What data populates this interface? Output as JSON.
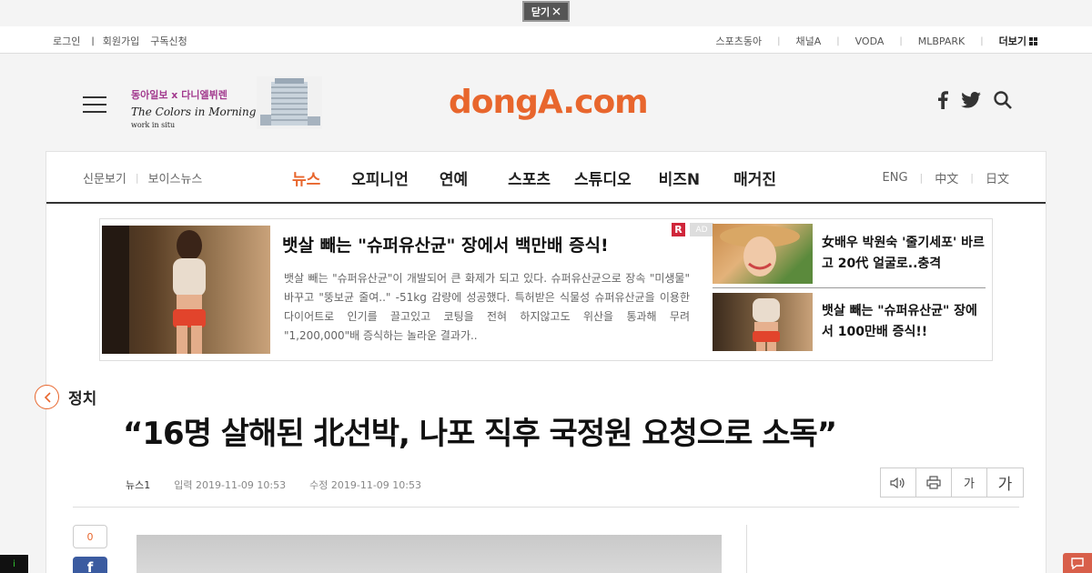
{
  "closebar": {
    "label": "닫기",
    "icon": "close-icon"
  },
  "util": {
    "left": [
      "로그인",
      "회원가입",
      "구독신청"
    ],
    "right": [
      "스포츠동아",
      "채널A",
      "VODA",
      "MLBPARK"
    ],
    "more": "더보기"
  },
  "header": {
    "banner": {
      "line1": "동아일보 x 다니엘뷔렌",
      "line2": "The Colors in Morning Calm",
      "line3": "work in situ"
    },
    "logo": "dongA.com",
    "social_icons": [
      "facebook-icon",
      "twitter-icon",
      "search-icon"
    ]
  },
  "nav": {
    "left": [
      "신문보기",
      "보이스뉴스"
    ],
    "main": [
      "뉴스",
      "오피니언",
      "연예",
      "스포츠",
      "스튜디오",
      "비즈N",
      "매거진"
    ],
    "active": "뉴스",
    "right": [
      "ENG",
      "中文",
      "日文"
    ]
  },
  "ad": {
    "badge": "R",
    "badge2": "AD",
    "title": "뱃살 빼는 \"슈퍼유산균\" 장에서 백만배 증식!",
    "body": "뱃살 빼는 \"슈퍼유산균\"이 개발되어 큰 화제가 되고 있다. 슈퍼유산균으로 장속 \"미생물\" 바꾸고 \"뚱보균 줄여..\" -51kg 감량에 성공했다. 특허받은 식물성 슈퍼유산균을 이용한 다이어트로 인기를 끌고있고 코팅을 전혀 하지않고도 위산을 통과해 무려 \"1,200,000\"배 증식하는 놀라운 결과가..",
    "items": [
      {
        "text": "女배우 박원숙 '줄기세포' 바르고 20代 얼굴로..충격"
      },
      {
        "text": "뱃살 빼는 \"슈퍼유산균\" 장에서 100만배 증식!!"
      }
    ]
  },
  "article": {
    "section": "정치",
    "headline": "“16명 살해된 北선박, 나포 직후 국정원 요청으로 소독”",
    "author": "뉴스1",
    "published": "입력 2019-11-09 10:53",
    "modified": "수정 2019-11-09 10:53",
    "share_count": "0",
    "tools": {
      "font_small": "가",
      "font_large": "가"
    }
  },
  "colors": {
    "accent": "#e8662d",
    "facebook": "#3b5ba0",
    "ad_badge": "#d0263a"
  }
}
